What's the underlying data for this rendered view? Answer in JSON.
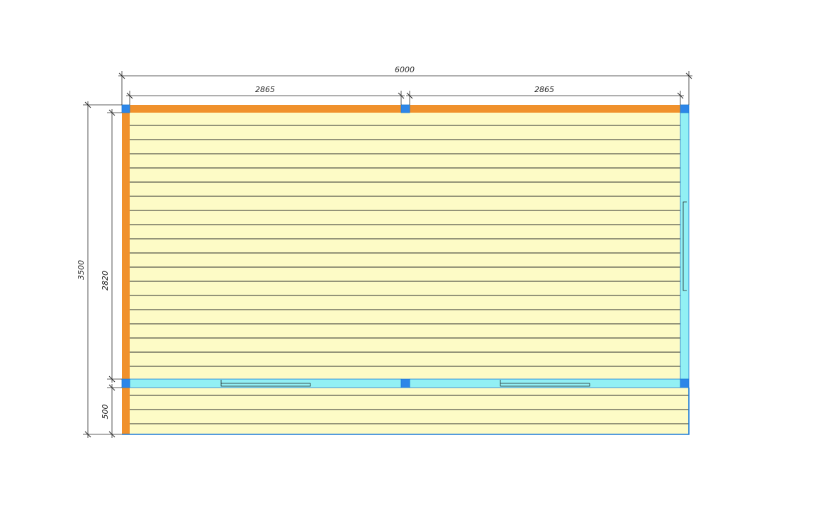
{
  "plan": {
    "dimensions": {
      "total_width": "6000",
      "left_section_width": "2865",
      "right_section_width": "2865",
      "total_depth": "3500",
      "room_depth": "2820",
      "terrace_depth": "500"
    },
    "colors": {
      "floor": "#fdfbc6",
      "board_line": "#2c2c2c",
      "wall_solid": "#f0912c",
      "wall_glazed": "#92f0f4",
      "post": "#2d86e8",
      "outline": "#1b7bd8",
      "dimension_line": "#2a2a2a"
    }
  }
}
